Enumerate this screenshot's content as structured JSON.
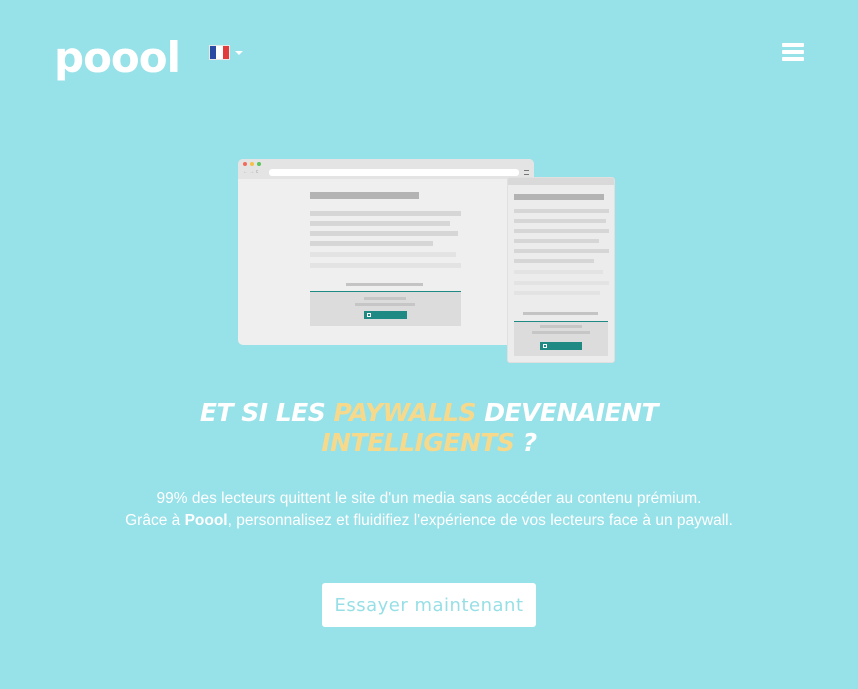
{
  "header": {
    "logo_text": "poool",
    "language": {
      "icon": "france-flag-icon",
      "flag_colors": [
        "#2b4aa3",
        "#ffffff",
        "#e23b3b"
      ]
    },
    "menu_icon": "hamburger-menu-icon"
  },
  "hero": {
    "headline": {
      "part1": "ET SI LES ",
      "highlight1": "PAYWALLS",
      "part2": " DEVENAIENT",
      "highlight2": "INTELLIGENTS",
      "part3": " ?"
    },
    "description": {
      "line1": "99% des lecteurs quittent le site d'un media sans accéder au contenu prémium.",
      "line2_prefix": "Grâce à ",
      "brand": "Poool",
      "line2_suffix": ", personnalisez et fluidifiez l'expérience de vos lecteurs face à un paywall."
    },
    "cta_label": "Essayer maintenant"
  },
  "colors": {
    "background": "#97e1e8",
    "highlight": "#f7d98c",
    "accent": "#1f8a84"
  }
}
